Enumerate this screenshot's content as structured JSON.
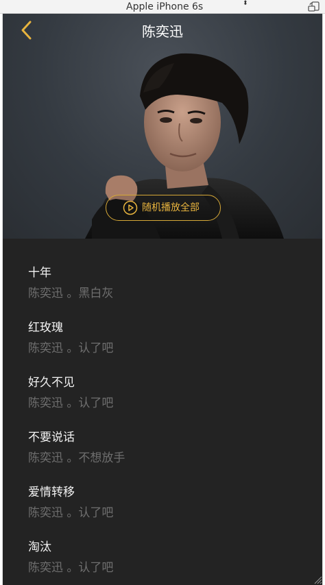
{
  "browser": {
    "device_name": "Apple iPhone 6s",
    "device_arrows": "⬍",
    "rotate_icon": "rotate-icon"
  },
  "header": {
    "title": "陈奕迅",
    "back_icon": "chevron-left-icon"
  },
  "hero": {
    "shuffle_label": "随机播放全部",
    "shuffle_icon": "play-circle-icon"
  },
  "colors": {
    "accent": "#E8B43E",
    "background": "#232323",
    "title_text": "#F2F2F2",
    "subtitle_text": "#6F6F6F"
  },
  "songs": [
    {
      "title": "十年",
      "subtitle": "陈奕迅 。黑白灰"
    },
    {
      "title": "红玫瑰",
      "subtitle": "陈奕迅 。认了吧"
    },
    {
      "title": "好久不见",
      "subtitle": "陈奕迅 。认了吧"
    },
    {
      "title": "不要说话",
      "subtitle": "陈奕迅 。不想放手"
    },
    {
      "title": "爱情转移",
      "subtitle": "陈奕迅 。认了吧"
    },
    {
      "title": "淘汰",
      "subtitle": "陈奕迅 。认了吧"
    }
  ]
}
